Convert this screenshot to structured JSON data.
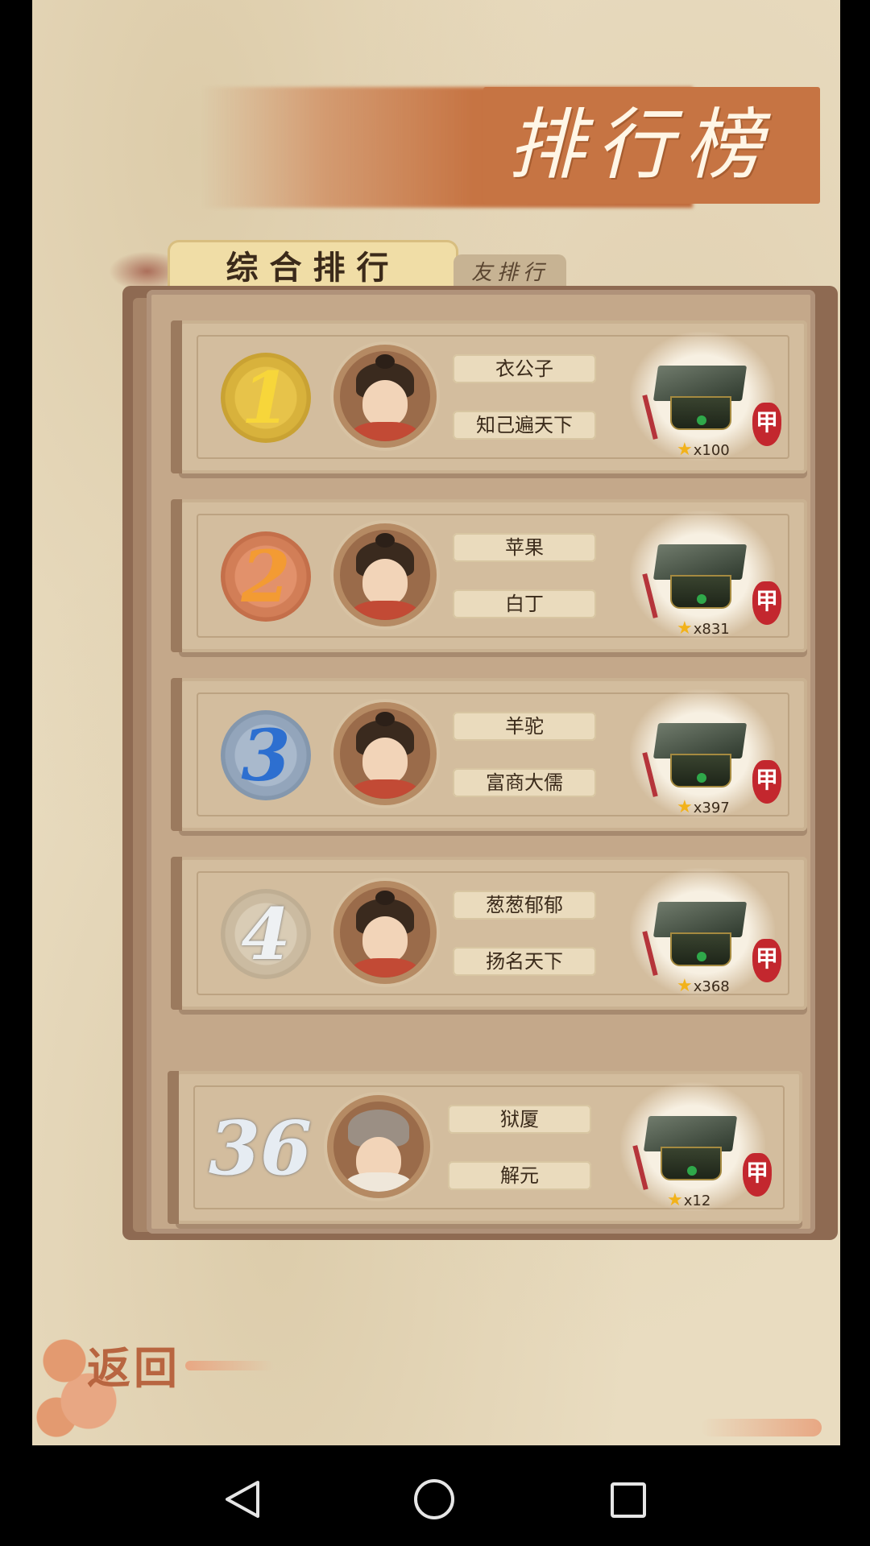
{
  "header": {
    "title": "排行榜"
  },
  "tabs": [
    {
      "label": "综合排行",
      "active": true
    },
    {
      "label": "友排行",
      "active": false
    }
  ],
  "leaderboard": [
    {
      "rank": "1",
      "rank_color": "#e7b926",
      "name": "衣公子",
      "title": "知己遍天下",
      "reward_count": "x100",
      "seal": "甲"
    },
    {
      "rank": "2",
      "rank_color": "#f09a35",
      "name": "苹果",
      "title": "白丁",
      "reward_count": "x831",
      "seal": "甲"
    },
    {
      "rank": "3",
      "rank_color": "#2d6fd0",
      "name": "羊驼",
      "title": "富商大儒",
      "reward_count": "x397",
      "seal": "甲"
    },
    {
      "rank": "4",
      "rank_color": "#eef1f3",
      "name": "葱葱郁郁",
      "title": "扬名天下",
      "reward_count": "x368",
      "seal": "甲"
    }
  ],
  "my_rank": {
    "rank": "36",
    "rank_color": "#e6ecf2",
    "name": "狱厦",
    "title": "解元",
    "reward_count": "x12",
    "seal": "甲"
  },
  "footer": {
    "back_label": "返回"
  },
  "navbar": {
    "icons": [
      "back-triangle-icon",
      "home-circle-icon",
      "recents-square-icon"
    ]
  }
}
